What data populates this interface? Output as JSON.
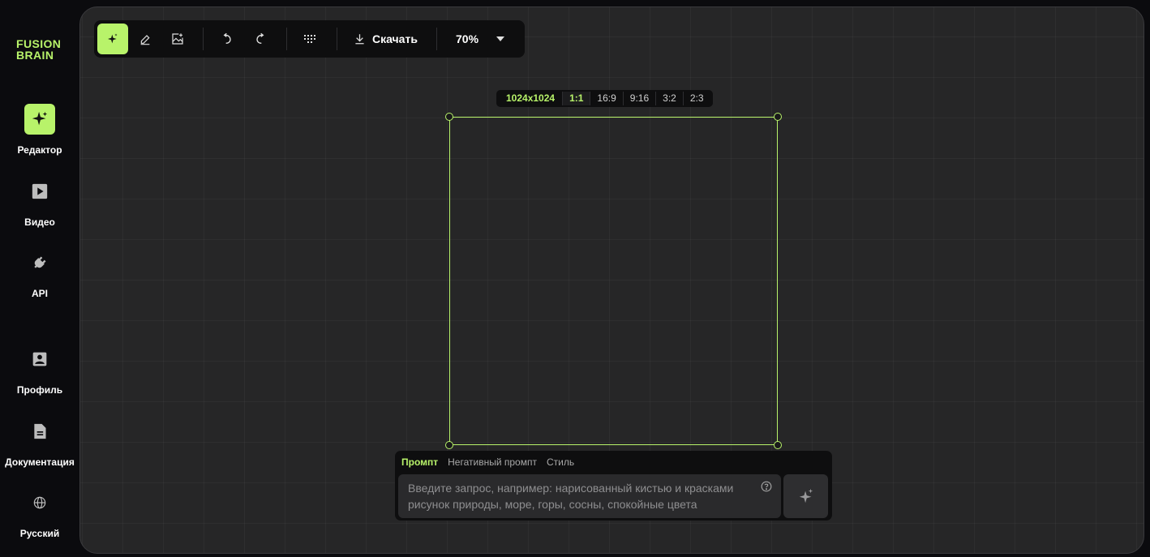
{
  "brand": {
    "line1": "FUSION",
    "line2": "BRAIN",
    "color": "#b8f36a"
  },
  "sidebar": {
    "items": [
      {
        "label": "Редактор",
        "icon": "sparkle-icon",
        "active": true
      },
      {
        "label": "Видео",
        "icon": "video-icon"
      },
      {
        "label": "API",
        "icon": "plug-icon"
      },
      {
        "label": "Профиль",
        "icon": "profile-icon"
      },
      {
        "label": "Документация",
        "icon": "document-icon"
      },
      {
        "label": "Русский",
        "icon": "globe-icon"
      }
    ]
  },
  "toolbar": {
    "tools": [
      "generate-icon",
      "eraser-icon",
      "image-upload-icon",
      "undo-icon",
      "redo-icon",
      "grid-icon"
    ],
    "download_label": "Скачать",
    "zoom": "70%"
  },
  "ratio_bar": {
    "size": "1024x1024",
    "options": [
      "1:1",
      "16:9",
      "9:16",
      "3:2",
      "2:3"
    ],
    "selected": "1:1"
  },
  "prompt": {
    "tabs": [
      "Промпт",
      "Негативный промпт",
      "Стиль"
    ],
    "active_tab": "Промпт",
    "placeholder": "Введите запрос, например: нарисованный кистью и красками рисунок природы, море, горы, сосны, спокойные цвета",
    "value": ""
  },
  "colors": {
    "accent": "#b8f36a",
    "panel": "#262627",
    "toolbar": "#0e0e0f"
  }
}
